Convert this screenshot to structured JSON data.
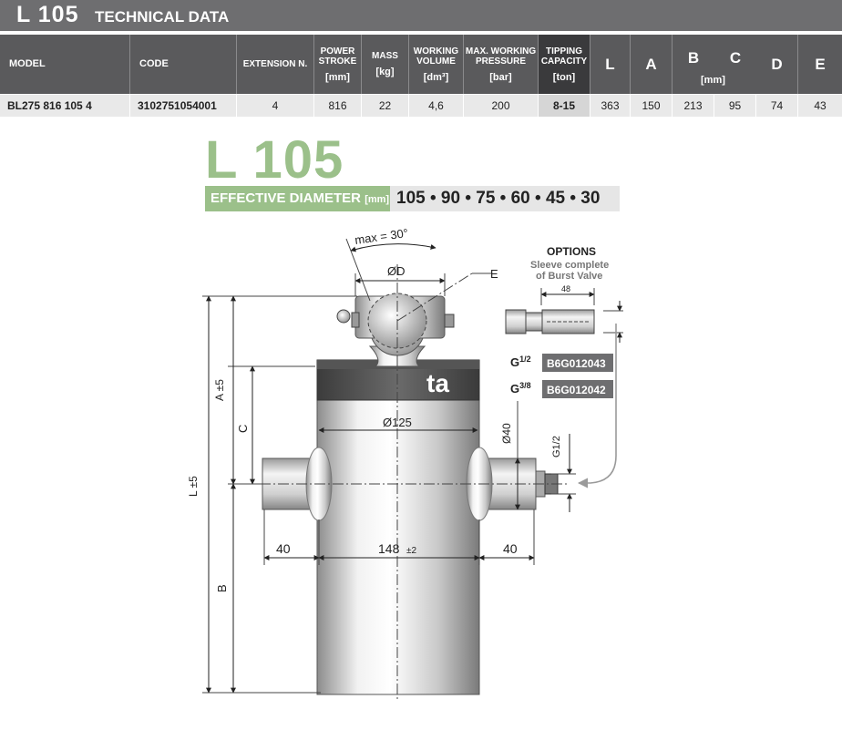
{
  "header": {
    "model": "L 105",
    "subtitle": "TECHNICAL DATA"
  },
  "table": {
    "columns": {
      "model": "MODEL",
      "code": "CODE",
      "extension": "EXTENSION N.",
      "stroke": "POWER STROKE",
      "stroke_unit": "[mm]",
      "mass": "MASS",
      "mass_unit": "[kg]",
      "volume": "WORKING VOLUME",
      "volume_unit": "[dm³]",
      "pressure": "MAX. WORKING PRESSURE",
      "pressure_unit": "[bar]",
      "tipping": "TIPPING CAPACITY",
      "tipping_unit": "[ton]",
      "L": "L",
      "A": "A",
      "B": "B",
      "C": "C",
      "D": "D",
      "E": "E",
      "dims_unit": "[mm]"
    },
    "row": {
      "model": "BL275 816 105 4",
      "code": "3102751054001",
      "extension": "4",
      "stroke": "816",
      "mass": "22",
      "volume": "4,6",
      "pressure": "200",
      "tipping": "8-15",
      "L": "363",
      "A": "150",
      "B": "213",
      "C": "95",
      "D": "74",
      "E": "43"
    }
  },
  "drawing": {
    "title": "L 105",
    "effective_label": "EFFECTIVE DIAMETER",
    "effective_unit": "[mm]",
    "effective_values": "105 • 90 • 75 • 60 • 45 • 30",
    "angle": "max = 30°",
    "dia_D": "ØD",
    "label_E": "E",
    "label_A": "A ±5",
    "label_C": "C",
    "label_L": "L ±5",
    "label_B": "B",
    "dia_125": "Ø125",
    "dia_40": "Ø40",
    "port_thread": "G1/2",
    "dim_40_left": "40",
    "dim_148": "148",
    "dim_148_tol": "±2",
    "dim_40_right": "40",
    "logo_text": "ta",
    "options": {
      "title": "OPTIONS",
      "line1": "Sleeve complete",
      "line2": "of Burst  Valve",
      "dim": "48",
      "opt1_thread_base": "G",
      "opt1_thread_frac": "1/2",
      "opt1_code": "B6G012043",
      "opt2_thread_base": "G",
      "opt2_thread_frac": "3/8",
      "opt2_code": "B6G012042"
    }
  },
  "colors": {
    "accent_green": "#9bc08a",
    "header_gray": "#5a5a5c",
    "title_gray": "#6e6e70"
  }
}
